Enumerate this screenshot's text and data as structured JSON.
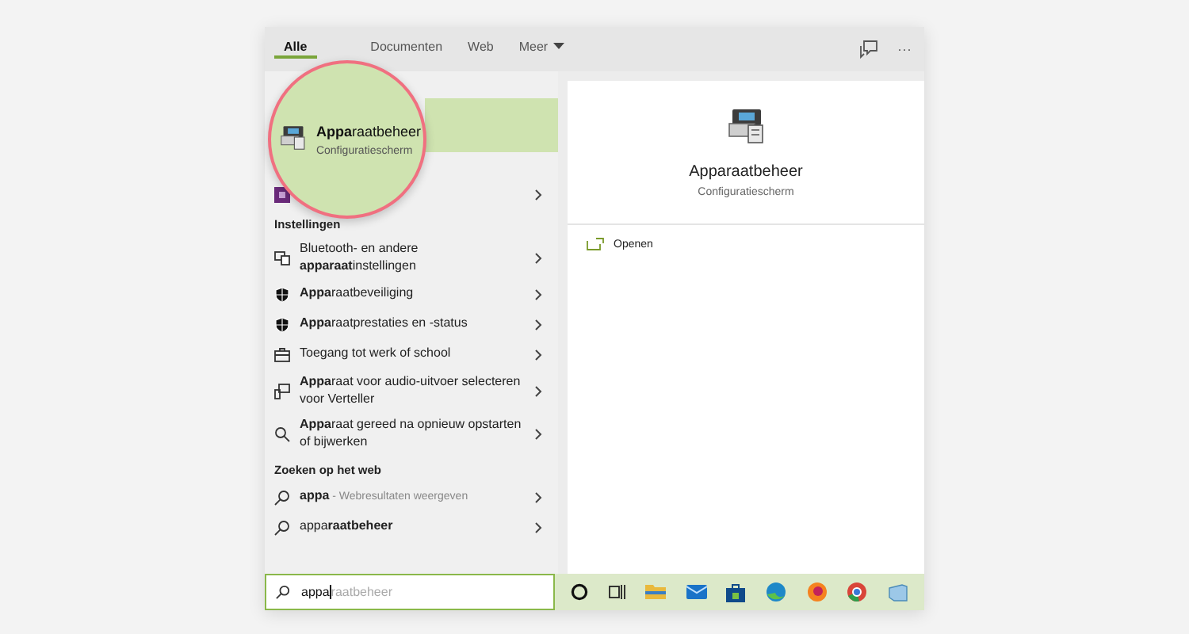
{
  "tabs": [
    {
      "label": "Alle",
      "selected": true
    },
    {
      "label": "Documenten",
      "selected": false
    },
    {
      "label": "Web",
      "selected": false
    },
    {
      "label": "Meer",
      "selected": false,
      "dropdown": true
    }
  ],
  "more": "···",
  "best_match": {
    "title": "**Appa**raatbeheer",
    "subtitle": "Configuratiescherm"
  },
  "apps": [
    {
      "kind": "app"
    }
  ],
  "settings_header": "Instellingen",
  "settings": [
    {
      "kind": "display",
      "text": "Bluetooth- en andere **apparaat**instellingen"
    },
    {
      "kind": "shield",
      "text": "**Appa**raatbeveiliging"
    },
    {
      "kind": "shield",
      "text": "**Appa**raatprestaties en -status"
    },
    {
      "kind": "briefcase",
      "text": "Toegang tot werk of school"
    },
    {
      "kind": "devices",
      "text": "**Appa**raat voor audio-uitvoer selecteren voor Verteller"
    },
    {
      "kind": "magnifier",
      "text": "**Appa**raat gereed na opnieuw opstarten of bijwerken"
    }
  ],
  "web_header": "Zoeken op het web",
  "web": [
    {
      "text": "**appa**",
      "suffix": " - Webresultaten weergeven"
    },
    {
      "text": "appa**raatbeheer**"
    }
  ],
  "search": {
    "value": "appa",
    "completion": "raatbeheer"
  },
  "preview": {
    "title": "Apparaatbeheer",
    "subtitle": "Configuratiescherm",
    "actions": [
      "Openen"
    ]
  },
  "taskbar": [
    {
      "kind": "circle"
    },
    {
      "kind": "taskview"
    },
    {
      "kind": "folder"
    },
    {
      "kind": "mail"
    },
    {
      "kind": "store"
    },
    {
      "kind": "edge"
    },
    {
      "kind": "firefox"
    },
    {
      "kind": "chrome"
    },
    {
      "kind": "window"
    }
  ]
}
